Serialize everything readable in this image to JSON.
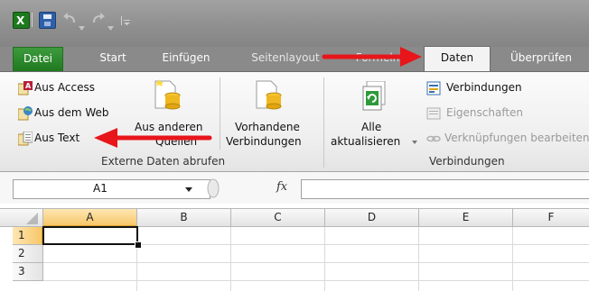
{
  "tabs": {
    "datei": "Datei",
    "start": "Start",
    "einfuegen": "Einfügen",
    "seitenlayout": "Seitenlayout",
    "formeln": "Formeln",
    "daten": "Daten",
    "ueberpruefen": "Überprüfen"
  },
  "ribbon": {
    "external": {
      "access": "Aus Access",
      "web": "Aus dem Web",
      "text": "Aus Text",
      "other_line1": "Aus anderen",
      "other_line2": "Quellen",
      "existing_line1": "Vorhandene",
      "existing_line2": "Verbindungen",
      "group_label": "Externe Daten abrufen"
    },
    "connections": {
      "refresh_line1": "Alle",
      "refresh_line2": "aktualisieren",
      "connections": "Verbindungen",
      "properties": "Eigenschaften",
      "edit_links": "Verknüpfungen bearbeiten",
      "group_label": "Verbindungen"
    }
  },
  "formula_bar": {
    "name_box": "A1",
    "fx": "fx"
  },
  "grid": {
    "columns": [
      "A",
      "B",
      "C",
      "D",
      "E",
      "F"
    ],
    "rows": [
      "1",
      "2",
      "3"
    ]
  },
  "colors": {
    "excel_green": "#1f7a1f",
    "arrow_red": "#e8151b",
    "selection_orange": "#f8c76a"
  }
}
